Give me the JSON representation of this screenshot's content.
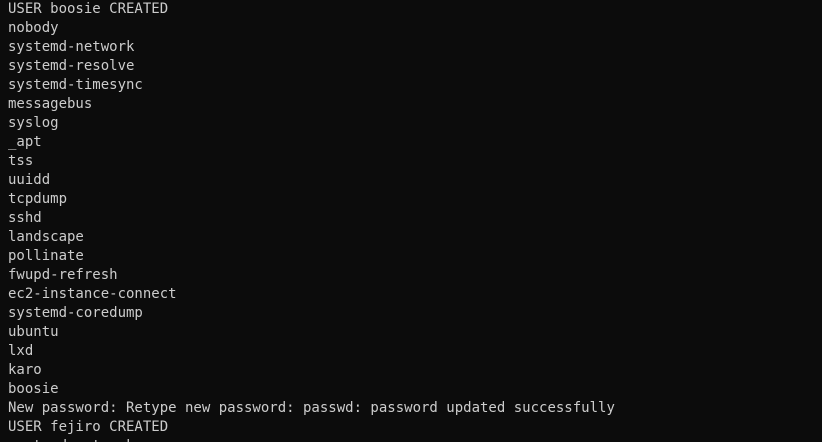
{
  "terminal": {
    "lines": [
      "USER boosie CREATED",
      "nobody",
      "systemd-network",
      "systemd-resolve",
      "systemd-timesync",
      "messagebus",
      "syslog",
      "_apt",
      "tss",
      "uuidd",
      "tcpdump",
      "sshd",
      "landscape",
      "pollinate",
      "fwupd-refresh",
      "ec2-instance-connect",
      "systemd-coredump",
      "ubuntu",
      "lxd",
      "karo",
      "boosie",
      "New password: Retype new password: passwd: password updated successfully",
      "USER fejiro CREATED",
      "systemd-network"
    ]
  }
}
